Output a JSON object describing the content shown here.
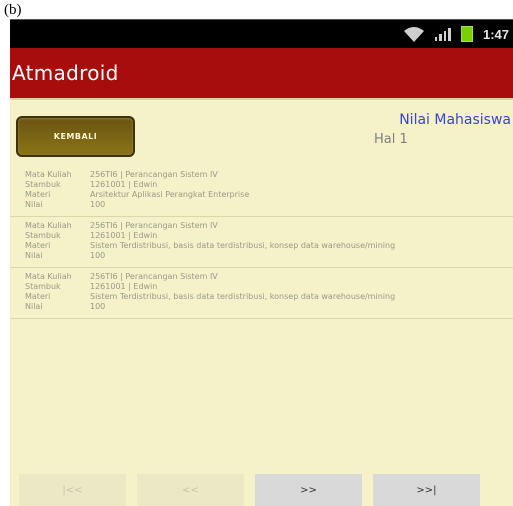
{
  "caption": "(b)",
  "status_bar": {
    "time": "1:47"
  },
  "app": {
    "title": "Atmadroid"
  },
  "header": {
    "back_button": "KEMBALI",
    "title": "Nilai Mahasiswa",
    "page": "Hal 1"
  },
  "labels": {
    "course": "Mata Kuliah",
    "student": "Stambuk",
    "topic": "Materi",
    "grade": "Nilai"
  },
  "records": [
    {
      "course": "256TI6 | Perancangan Sistem IV",
      "student": "1261001 | Edwin",
      "topic": "Arsitektur Aplikasi Perangkat Enterprise",
      "grade": "100"
    },
    {
      "course": "256TI6 | Perancangan Sistem IV",
      "student": "1261001 | Edwin",
      "topic": "Sistem Terdistribusi, basis data terdistribusi, konsep data warehouse/mining",
      "grade": "100"
    },
    {
      "course": "256TI6 | Perancangan Sistem IV",
      "student": "1261001 | Edwin",
      "topic": "Sistem Terdistribusi, basis data terdistribusi, konsep data warehouse/mining",
      "grade": "100"
    }
  ],
  "pager": {
    "first": "|<<",
    "prev": "<<",
    "next": ">>",
    "last": ">>|"
  }
}
